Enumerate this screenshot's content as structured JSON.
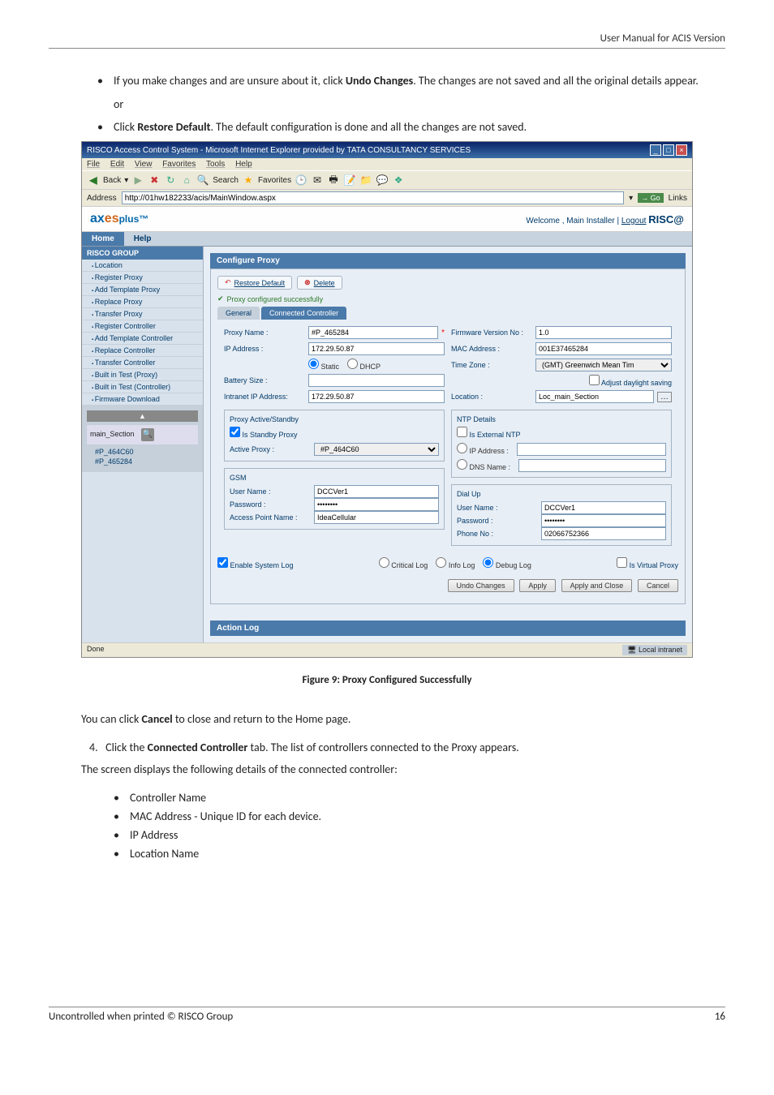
{
  "doc": {
    "header": "User Manual for ACIS Version",
    "bullet1_pre": "If you make changes and are unsure about it, click ",
    "bullet1_bold": "Undo Changes",
    "bullet1_post": ". The changes are not saved and all the original details appear.",
    "or": "or",
    "bullet2_pre": "Click ",
    "bullet2_bold": "Restore Default",
    "bullet2_post": ". The default configuration is done and all the changes are not saved.",
    "figure_caption": "Figure 9: Proxy Configured Successfully",
    "body1_pre": "You can click ",
    "body1_bold": "Cancel",
    "body1_post": " to close and return to the Home page.",
    "step4_num": "4.",
    "step4_pre": "Click the ",
    "step4_bold": "Connected Controller",
    "step4_post": " tab. The list of controllers connected to the Proxy appears.",
    "body2": "The screen displays the following details of the connected controller:",
    "sub_bullets": [
      "Controller Name",
      "MAC Address - Unique ID for each device.",
      "IP Address",
      "Location Name"
    ],
    "footer_left": "Uncontrolled when printed © RISCO Group",
    "footer_right": "16"
  },
  "ie": {
    "title": "RISCO Access Control System - Microsoft Internet Explorer provided by TATA CONSULTANCY SERVICES",
    "menu": [
      "File",
      "Edit",
      "View",
      "Favorites",
      "Tools",
      "Help"
    ],
    "back": "Back",
    "search": "Search",
    "fav": "Favorites",
    "address_label": "Address",
    "address": "http://01hw182233/acis/MainWindow.aspx",
    "go": "Go",
    "links": "Links",
    "done": "Done",
    "local": "Local intranet"
  },
  "app": {
    "brand_ax": "ax",
    "brand_es": "es",
    "brand_plus": "plus™",
    "welcome": "Welcome , Main Installer | ",
    "logout": "Logout",
    "risco": "RISC@",
    "tabs": [
      "Home",
      "Help"
    ]
  },
  "sidebar": {
    "header": "RISCO GROUP",
    "items": [
      "Location",
      "Register Proxy",
      "Add Template Proxy",
      "Replace Proxy",
      "Transfer Proxy",
      "Register Controller",
      "Add Template Controller",
      "Replace Controller",
      "Transfer Controller",
      "Built in Test (Proxy)",
      "Built in Test (Controller)",
      "Firmware Download"
    ],
    "main_section": "main_Section",
    "tree": [
      "#P_464C60",
      "#P_465284"
    ],
    "action_log": "Action Log"
  },
  "panel": {
    "title": "Configure Proxy",
    "restore": "Restore Default",
    "delete": "Delete",
    "success": "Proxy configured successfully",
    "tab_general": "General",
    "tab_connected": "Connected Controller",
    "labels": {
      "proxy_name": "Proxy Name :",
      "ip_address": "IP Address :",
      "battery": "Battery Size :",
      "intranet_ip": "Intranet IP Address:",
      "active_proxy": "Active Proxy :",
      "firmware": "Firmware Version No :",
      "mac": "MAC Address :",
      "timezone": "Time Zone :",
      "location": "Location :",
      "user_name": "User Name :",
      "password": "Password :",
      "apn": "Access Point Name :",
      "phone": "Phone No :",
      "ip_addr2": "IP Address :",
      "dns": "DNS Name :"
    },
    "values": {
      "proxy_name": "#P_465284",
      "ip_address": "172.29.50.87",
      "intranet_ip": "172.29.50.87",
      "active_proxy": "#P_464C60",
      "firmware": "1.0",
      "mac": "001E37465284",
      "timezone": "(GMT) Greenwich Mean Tim",
      "location": "Loc_main_Section",
      "gsm_user": "DCCVer1",
      "gsm_pass": "********",
      "apn": "IdeaCellular",
      "dial_user": "DCCVer1",
      "dial_pass": "********",
      "phone": "02066752366"
    },
    "radios": {
      "static": "Static",
      "dhcp": "DHCP"
    },
    "checks": {
      "standby": "Is Standby Proxy",
      "daylight": "Adjust daylight saving",
      "external_ntp": "Is External NTP",
      "enable_log": "Enable System Log",
      "virtual": "Is Virtual Proxy"
    },
    "fieldsets": {
      "active_standby": "Proxy Active/Standby",
      "gsm": "GSM",
      "ntp": "NTP Details",
      "dialup": "Dial Up"
    },
    "log_radios": {
      "critical": "Critical Log",
      "info": "Info Log",
      "debug": "Debug Log"
    },
    "buttons": {
      "undo": "Undo Changes",
      "apply": "Apply",
      "apply_close": "Apply and Close",
      "cancel": "Cancel"
    }
  }
}
